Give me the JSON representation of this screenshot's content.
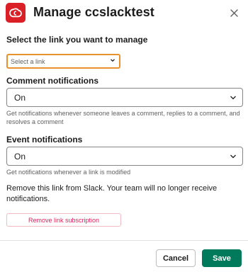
{
  "modal": {
    "title": "Manage ccslacktest",
    "logo_icon": "adobe-creative-cloud-icon",
    "close_icon": "close-icon"
  },
  "link": {
    "label": "Select the link you want to manage",
    "placeholder": "Select a link"
  },
  "comment": {
    "label": "Comment notifications",
    "value": "On",
    "help": "Get notifications whenever someone leaves a comment, replies to a comment, and resolves a comment"
  },
  "event": {
    "label": "Event notifications",
    "value": "On",
    "help": "Get notifications whenever a link is modified"
  },
  "remove": {
    "text": "Remove this link from Slack. Your team will no longer receive notifications.",
    "button": "Remove link subscription"
  },
  "footer": {
    "cancel": "Cancel",
    "save": "Save"
  },
  "colors": {
    "brand": "#da1f26",
    "focus_outline": "#e8912d",
    "danger": "#e01e5a",
    "primary": "#007a5a"
  }
}
